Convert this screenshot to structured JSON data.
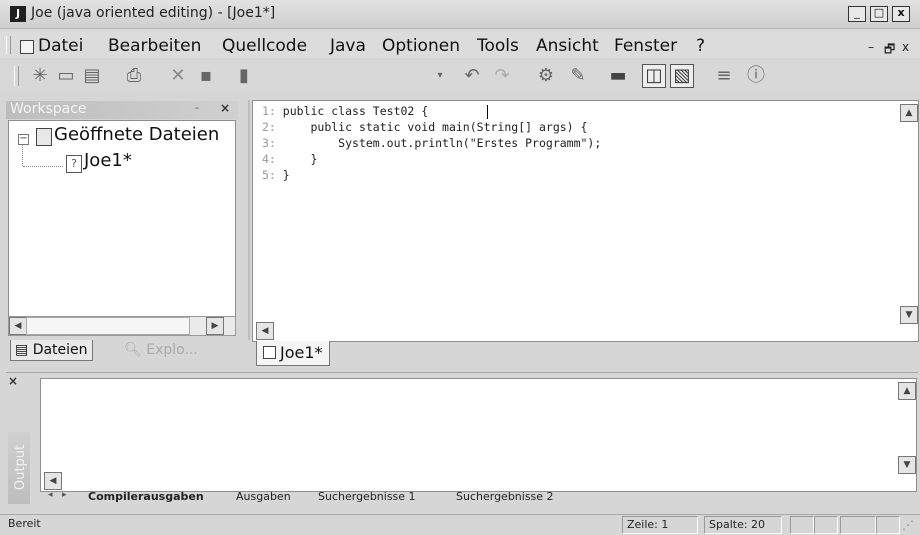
{
  "window": {
    "app_icon": "J",
    "title": "Joe (java oriented editing) - [Joe1*]",
    "btn_min": "_",
    "btn_max": "□",
    "btn_close": "x"
  },
  "menu": {
    "items": [
      "Datei",
      "Bearbeiten",
      "Quellcode",
      "Java",
      "Optionen",
      "Tools",
      "Ansicht",
      "Fenster",
      "?"
    ],
    "mdi_min": "–",
    "mdi_restore": "🗗",
    "mdi_close": "x"
  },
  "toolbar": {
    "icons": [
      "new-file-icon",
      "open-folder-icon",
      "save-icon",
      "print-icon",
      "delete-icon",
      "copy-icon",
      "paste-icon",
      "dropdown-icon",
      "undo-icon",
      "redo-icon",
      "settings-icon",
      "brush-icon",
      "monitor-icon",
      "panel-icon",
      "image-icon",
      "list-icon",
      "info-icon"
    ]
  },
  "workspace": {
    "title": "Workspace",
    "pin": "‐",
    "close": "×",
    "tree": {
      "root_label": "Geöffnete Dateien",
      "child_label": "Joe1*"
    },
    "tabs": [
      "Dateien",
      "Explo..."
    ]
  },
  "editor": {
    "lines": [
      {
        "num": "1:",
        "code": "public class Test02 {"
      },
      {
        "num": "2:",
        "code": "    public static void main(String[] args) {"
      },
      {
        "num": "3:",
        "code": "        System.out.println(\"Erstes Programm\");"
      },
      {
        "num": "4:",
        "code": "    }"
      },
      {
        "num": "5:",
        "code": "}"
      }
    ],
    "tab_label": "Joe1*"
  },
  "output": {
    "title": "Output",
    "close": "×",
    "tabs": [
      "Compilerausgaben",
      "Ausgaben",
      "Suchergebnisse 1",
      "Suchergebnisse 2"
    ],
    "active_tab": "Compilerausgaben"
  },
  "status": {
    "text": "Bereit",
    "line": "Zeile: 1",
    "column": "Spalte: 20"
  }
}
